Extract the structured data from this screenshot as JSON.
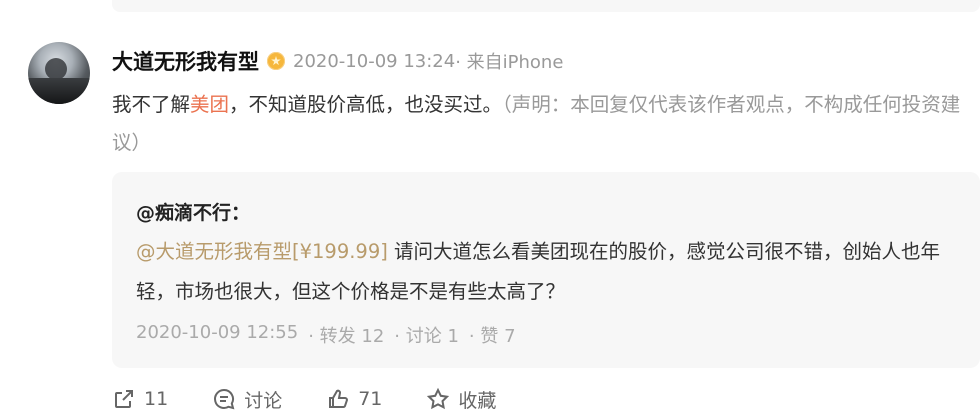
{
  "reply": {
    "username": "大道无形我有型",
    "timestamp": "2020-10-09 13:24",
    "source": "· 来自iPhone",
    "text_before": "我不了解",
    "link_text": "美团",
    "text_after": "，不知道股价高低，也没买过。",
    "disclaimer": "（声明：本回复仅代表该作者观点，不构成任何投资建议）"
  },
  "quote": {
    "author": "@痴滴不行",
    "author_suffix": "：",
    "mention": "@大道无形我有型[¥199.99]",
    "body": " 请问大道怎么看美团现在的股价，感觉公司很不错，创始人也年轻，市场也很大，但这个价格是不是有些太高了？",
    "timestamp": "2020-10-09 12:55",
    "repost": "· 转发 12",
    "comments": "· 讨论 1",
    "likes": "· 赞 7"
  },
  "actions": {
    "share_count": "11",
    "discuss_label": "讨论",
    "like_count": "71",
    "favorite_label": "收藏"
  },
  "icons": {
    "share": "share-icon",
    "discuss": "comment-icon",
    "like": "thumbs-up-icon",
    "favorite": "star-icon"
  },
  "colors": {
    "link": "#eb7350",
    "mention": "#b89b6b",
    "muted": "#999999",
    "quote_bg": "#f7f7f7"
  }
}
